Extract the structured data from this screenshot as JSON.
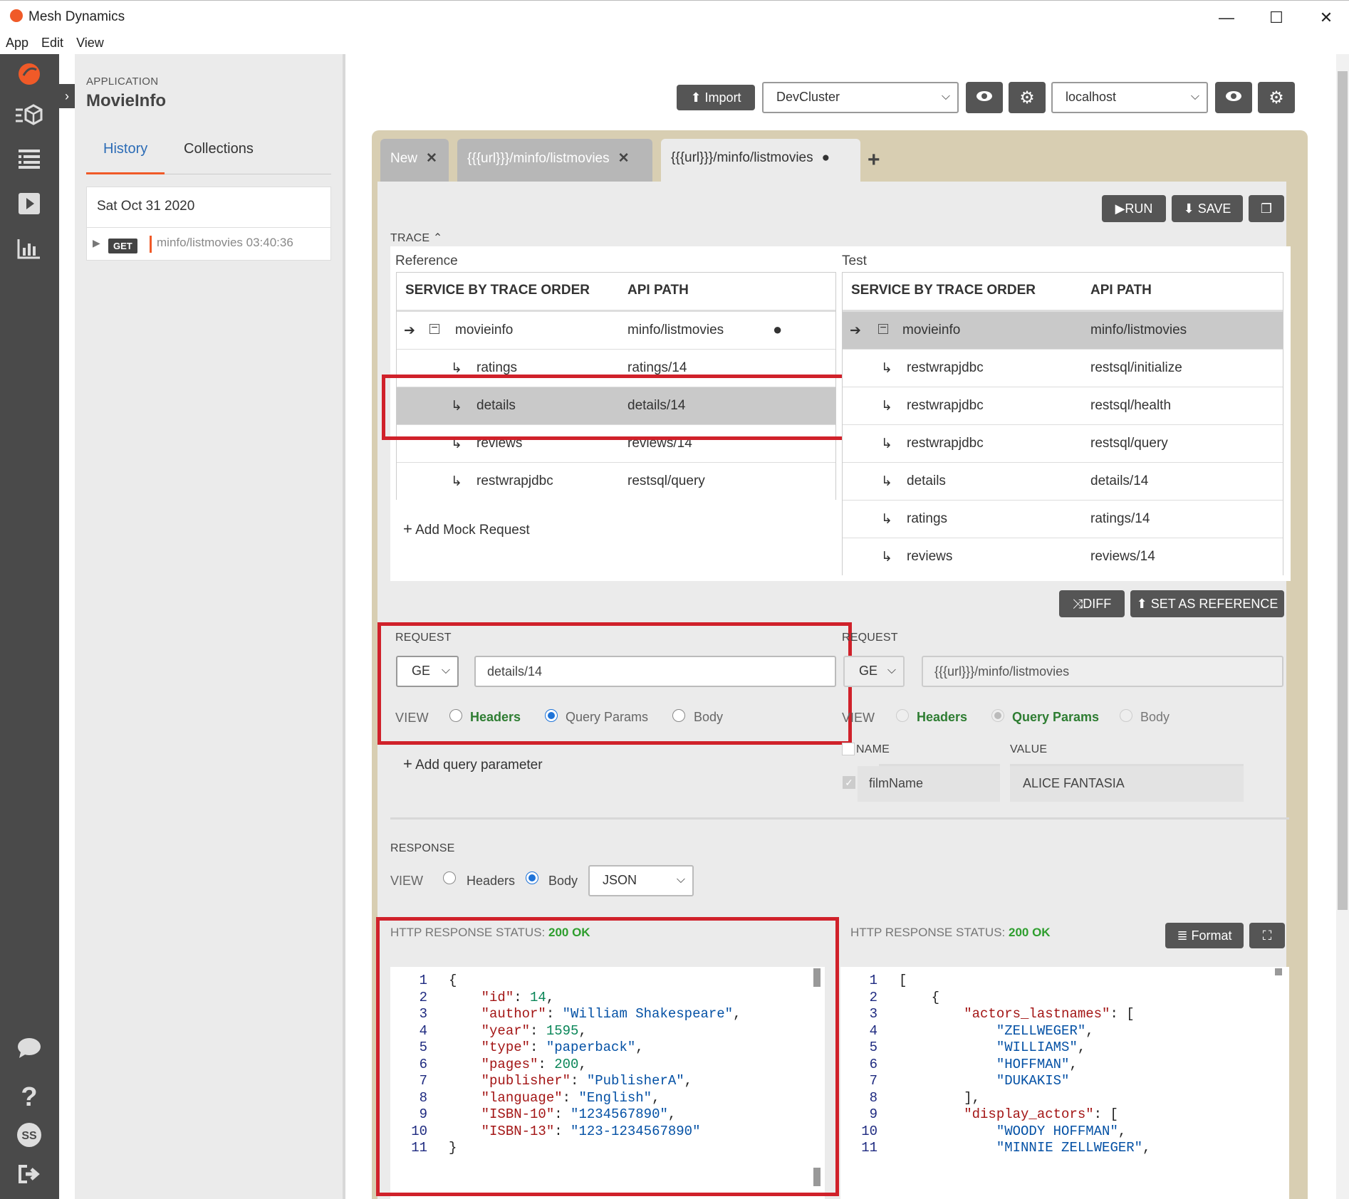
{
  "window": {
    "title": "Mesh Dynamics",
    "minimize": "—",
    "maximize": "☐",
    "close": "✕"
  },
  "menu": [
    "App",
    "Edit",
    "View"
  ],
  "side": {
    "app_label": "APPLICATION",
    "app_name": "MovieInfo",
    "tabs": [
      "History",
      "Collections"
    ],
    "history": {
      "date": "Sat Oct 31 2020",
      "method": "GET",
      "path": "minfo/listmovies 03:40:36"
    }
  },
  "toolbar": {
    "import": "Import",
    "cluster": "DevCluster",
    "host": "localhost"
  },
  "tabs": [
    {
      "label": "New"
    },
    {
      "label": "{{{url}}}/minfo/listmovies"
    },
    {
      "label": "{{{url}}}/minfo/listmovies"
    }
  ],
  "actions": {
    "run": "RUN",
    "save": "SAVE",
    "diff": "DIFF",
    "set_ref": "SET AS REFERENCE",
    "format": "Format",
    "add_tab": "+"
  },
  "trace": {
    "label": "TRACE",
    "reference_label": "Reference",
    "test_label": "Test",
    "col_service": "SERVICE BY TRACE ORDER",
    "col_api": "API PATH",
    "reference_rows": [
      {
        "service": "movieinfo",
        "api": "minfo/listmovies"
      },
      {
        "service": "ratings",
        "api": "ratings/14"
      },
      {
        "service": "details",
        "api": "details/14"
      },
      {
        "service": "reviews",
        "api": "reviews/14"
      },
      {
        "service": "restwrapjdbc",
        "api": "restsql/query"
      }
    ],
    "test_rows": [
      {
        "service": "movieinfo",
        "api": "minfo/listmovies"
      },
      {
        "service": "restwrapjdbc",
        "api": "restsql/initialize"
      },
      {
        "service": "restwrapjdbc",
        "api": "restsql/health"
      },
      {
        "service": "restwrapjdbc",
        "api": "restsql/query"
      },
      {
        "service": "details",
        "api": "details/14"
      },
      {
        "service": "ratings",
        "api": "ratings/14"
      },
      {
        "service": "reviews",
        "api": "reviews/14"
      }
    ],
    "add_mock": "Add Mock Request"
  },
  "request_left": {
    "label": "REQUEST",
    "method": "GE",
    "url": "details/14",
    "view_label": "VIEW",
    "views": [
      "Headers",
      "Query Params",
      "Body"
    ],
    "add_param": "Add query parameter"
  },
  "request_right": {
    "label": "REQUEST",
    "method": "GE",
    "url": "{{{url}}}/minfo/listmovies",
    "view_label": "VIEW",
    "views": [
      "Headers",
      "Query Params",
      "Body"
    ],
    "col_name": "NAME",
    "col_value": "VALUE",
    "param_name": "filmName",
    "param_value": "ALICE FANTASIA"
  },
  "response": {
    "label": "RESPONSE",
    "view_label": "VIEW",
    "views": [
      "Headers",
      "Body"
    ],
    "format": "JSON",
    "status_label": "HTTP RESPONSE STATUS:",
    "status_value": "200 OK"
  },
  "code_left": [
    {
      "n": "1",
      "t": "{"
    },
    {
      "n": "2",
      "k": "\"id\"",
      "v": "14",
      "vt": "n",
      "c": ","
    },
    {
      "n": "3",
      "k": "\"author\"",
      "v": "\"William Shakespeare\"",
      "vt": "s",
      "c": ","
    },
    {
      "n": "4",
      "k": "\"year\"",
      "v": "1595",
      "vt": "n",
      "c": ","
    },
    {
      "n": "5",
      "k": "\"type\"",
      "v": "\"paperback\"",
      "vt": "s",
      "c": ","
    },
    {
      "n": "6",
      "k": "\"pages\"",
      "v": "200",
      "vt": "n",
      "c": ","
    },
    {
      "n": "7",
      "k": "\"publisher\"",
      "v": "\"PublisherA\"",
      "vt": "s",
      "c": ","
    },
    {
      "n": "8",
      "k": "\"language\"",
      "v": "\"English\"",
      "vt": "s",
      "c": ","
    },
    {
      "n": "9",
      "k": "\"ISBN-10\"",
      "v": "\"1234567890\"",
      "vt": "s",
      "c": ","
    },
    {
      "n": "10",
      "k": "\"ISBN-13\"",
      "v": "\"123-1234567890\"",
      "vt": "s",
      "c": ""
    },
    {
      "n": "11",
      "t": "}"
    }
  ],
  "code_right": [
    {
      "n": "1",
      "t": "["
    },
    {
      "n": "2",
      "t": "    {"
    },
    {
      "n": "3",
      "k": "        \"actors_lastnames\"",
      "v": "[",
      "vt": "p",
      "c": ""
    },
    {
      "n": "4",
      "s": "            \"ZELLWEGER\"",
      "c": ","
    },
    {
      "n": "5",
      "s": "            \"WILLIAMS\"",
      "c": ","
    },
    {
      "n": "6",
      "s": "            \"HOFFMAN\"",
      "c": ","
    },
    {
      "n": "7",
      "s": "            \"DUKAKIS\"",
      "c": ""
    },
    {
      "n": "8",
      "t": "        ],"
    },
    {
      "n": "9",
      "k": "        \"display_actors\"",
      "v": "[",
      "vt": "p",
      "c": ""
    },
    {
      "n": "10",
      "s": "            \"WOODY HOFFMAN\"",
      "c": ","
    },
    {
      "n": "11",
      "s": "            \"MINNIE ZELLWEGER\"",
      "c": ","
    }
  ],
  "colors": {
    "accent": "#f05a28",
    "link": "#2c6cb6",
    "status_ok": "#2e9e2e",
    "highlight": "#d0212a"
  }
}
